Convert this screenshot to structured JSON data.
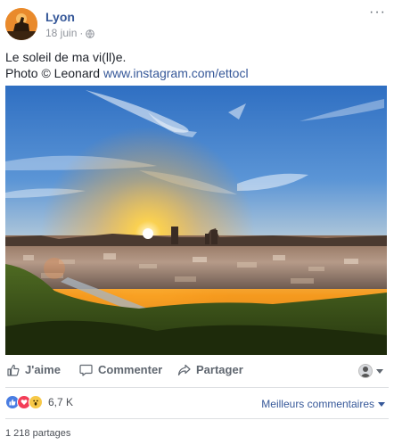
{
  "post": {
    "page_name": "Lyon",
    "date": "18 juin",
    "separator": "·",
    "more": "···",
    "text_line1": "Le soleil de ma vi(ll)e.",
    "text_line2_prefix": "Photo © Leonard ",
    "text_link": "www.instagram.com/ettocl"
  },
  "actions": {
    "like_label": "J'aime",
    "comment_label": "Commenter",
    "share_label": "Partager"
  },
  "stats": {
    "reaction_count": "6,7 K",
    "best_comments_label": "Meilleurs commentaires",
    "shares_label": "1 218 partages"
  },
  "colors": {
    "link": "#365899",
    "like": "#4a7de2",
    "love": "#f33e58",
    "wow": "#f7c847"
  },
  "icons": [
    "globe-icon",
    "more-icon",
    "like-icon",
    "comment-icon",
    "share-icon",
    "caret-down-icon"
  ]
}
